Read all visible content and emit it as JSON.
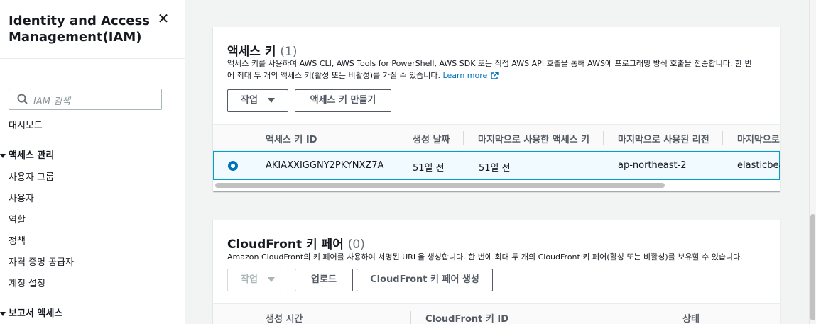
{
  "sidebar": {
    "title": "Identity and Access Management(IAM)",
    "close_icon": "close-icon",
    "search_placeholder": "IAM 검색",
    "dashboard": "대시보드",
    "section_access": "액세스 관리",
    "items": [
      "사용자 그룹",
      "사용자",
      "역할",
      "정책",
      "자격 증명 공급자",
      "계정 설정"
    ],
    "section_reports": "보고서 액세스"
  },
  "access_keys": {
    "title": "액세스 키",
    "count": "(1)",
    "desc_line1": "액세스 키를 사용하여 AWS CLI, AWS Tools for PowerShell, AWS SDK 또는 직접 AWS API 호출을 통해 AWS에 프로그래밍 방식 호출을 전송합니다. 한 번",
    "desc_line2": "에 최대 두 개의 액세스 키(활성 또는 비활성)를 가질 수 있습니다.",
    "learn_more": "Learn more",
    "actions_button": "작업",
    "create_button": "액세스 키 만들기",
    "columns": [
      "액세스 키 ID",
      "생성 날짜",
      "마지막으로 사용한 액세스 키",
      "마지막으로 사용된 리전",
      "마지막으로"
    ],
    "rows": [
      {
        "id": "AKIAXXIGGNY2PKYNXZ7A",
        "created": "51일 전",
        "last_used": "51일 전",
        "region": "ap-northeast-2",
        "service": "elasticbea"
      }
    ]
  },
  "cloudfront": {
    "title": "CloudFront 키 페어",
    "count": "(0)",
    "desc": "Amazon CloudFront의 키 페어를 사용하여 서명된 URL을 생성합니다. 한 번에 최대 두 개의 CloudFront 키 페어(활성 또는 비활성)를 보유할 수 있습니다.",
    "actions_button": "작업",
    "upload_button": "업로드",
    "create_button": "CloudFront 키 페어 생성",
    "columns": [
      "생성 시간",
      "CloudFront 키 ID",
      "상태"
    ]
  },
  "colors": {
    "accent": "#0073bb",
    "selected_row": "#f1faff",
    "selected_border": "#00a1c9"
  }
}
